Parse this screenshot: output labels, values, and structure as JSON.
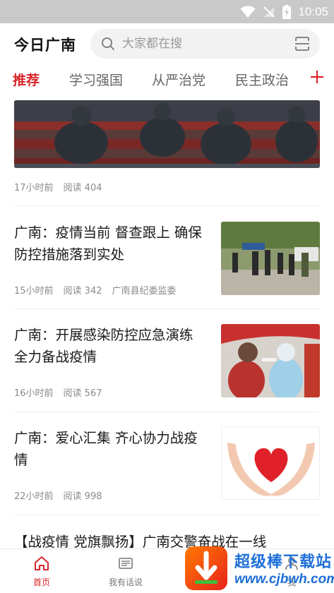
{
  "status_bar": {
    "time": "10:05",
    "icons": [
      "wifi-icon",
      "signal-off-icon",
      "battery-charging-icon"
    ]
  },
  "header": {
    "app_title": "今日广南",
    "search_placeholder": "大家都在搜"
  },
  "tabs": [
    {
      "label": "推荐",
      "active": true
    },
    {
      "label": "学习强国",
      "active": false
    },
    {
      "label": "从严治党",
      "active": false
    },
    {
      "label": "民主政治",
      "active": false
    }
  ],
  "feed": {
    "hero": {
      "time": "17小时前",
      "reads": "阅读 404"
    },
    "articles": [
      {
        "title": "广南：疫情当前 督查跟上 确保防控措施落到实处",
        "time": "15小时前",
        "reads": "阅读 342",
        "source": "广南县纪委监委"
      },
      {
        "title": "广南：开展感染防控应急演练 全力备战疫情",
        "time": "16小时前",
        "reads": "阅读 567",
        "source": ""
      },
      {
        "title": "广南：爱心汇集 齐心协力战疫情",
        "time": "22小时前",
        "reads": "阅读 998",
        "source": ""
      }
    ],
    "partial_article_title": "【战疫情 党旗飘扬】广南交警奋战在一线"
  },
  "bottom_nav": [
    {
      "label": "首页",
      "icon": "home-icon",
      "active": true
    },
    {
      "label": "我有话说",
      "icon": "newspaper-icon",
      "active": false
    },
    {
      "label": "我",
      "icon": "profile-icon",
      "active": false
    }
  ],
  "watermark": {
    "title": "超级棒下载站",
    "url": "www.cjbwh.com"
  },
  "colors": {
    "accent": "#d9262a",
    "status_bar": "#c9c9c9",
    "watermark_blue": "#1e6fd8"
  }
}
